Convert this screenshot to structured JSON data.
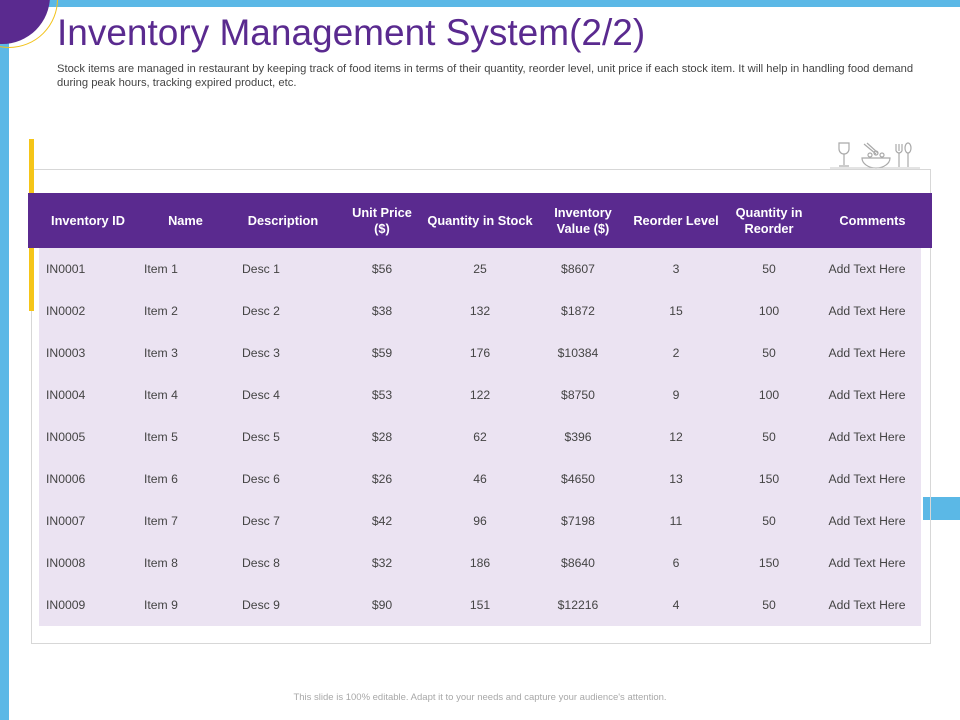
{
  "title": "Inventory Management System(2/2)",
  "subtitle": "Stock items are managed in restaurant by keeping track of food items in terms of their quantity, reorder level, unit price if each stock item. It will help in handling food demand during peak hours, tracking expired product, etc.",
  "table": {
    "headers": [
      "Inventory ID",
      "Name",
      "Description",
      "Unit Price ($)",
      "Quantity in Stock",
      "Inventory Value ($)",
      "Reorder Level",
      "Quantity in Reorder",
      "Comments"
    ],
    "rows": [
      [
        "IN0001",
        "Item 1",
        "Desc 1",
        "$56",
        "25",
        "$8607",
        "3",
        "50",
        "Add Text Here"
      ],
      [
        "IN0002",
        "Item 2",
        "Desc 2",
        "$38",
        "132",
        "$1872",
        "15",
        "100",
        "Add Text Here"
      ],
      [
        "IN0003",
        "Item 3",
        "Desc 3",
        "$59",
        "176",
        "$10384",
        "2",
        "50",
        "Add Text Here"
      ],
      [
        "IN0004",
        "Item 4",
        "Desc 4",
        "$53",
        "122",
        "$8750",
        "9",
        "100",
        "Add Text Here"
      ],
      [
        "IN0005",
        "Item 5",
        "Desc 5",
        "$28",
        "62",
        "$396",
        "12",
        "50",
        "Add Text Here"
      ],
      [
        "IN0006",
        "Item 6",
        "Desc 6",
        "$26",
        "46",
        "$4650",
        "13",
        "150",
        "Add Text Here"
      ],
      [
        "IN0007",
        "Item 7",
        "Desc 7",
        "$42",
        "96",
        "$7198",
        "11",
        "50",
        "Add Text Here"
      ],
      [
        "IN0008",
        "Item 8",
        "Desc 8",
        "$32",
        "186",
        "$8640",
        "6",
        "150",
        "Add Text Here"
      ],
      [
        "IN0009",
        "Item 9",
        "Desc 9",
        "$90",
        "151",
        "$12216",
        "4",
        "50",
        "Add Text Here"
      ]
    ]
  },
  "icons": [
    "wine-glass-icon",
    "food-bowl-icon",
    "fork-spoon-icon"
  ],
  "footer": "This slide is 100% editable. Adapt it to your needs and capture your audience's attention.",
  "colors": {
    "accent_purple": "#5a2a8f",
    "accent_blue": "#5bb8e6",
    "accent_yellow": "#f5c518",
    "row_fill": "#ebe3f2"
  }
}
